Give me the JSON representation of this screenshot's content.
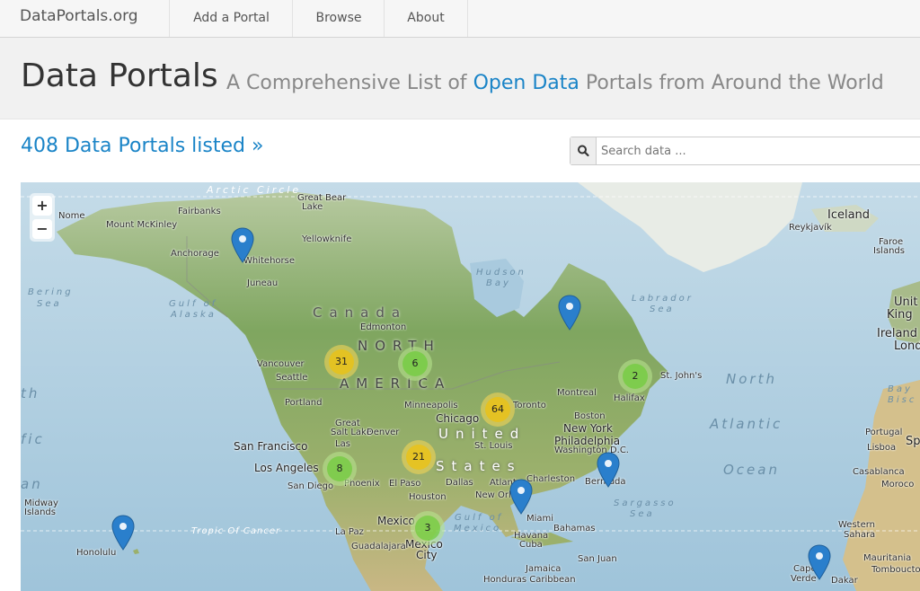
{
  "nav": {
    "brand": "DataPortals.org",
    "items": [
      {
        "label": "Add a Portal"
      },
      {
        "label": "Browse"
      },
      {
        "label": "About"
      }
    ]
  },
  "hero": {
    "title": "Data Portals",
    "subtitle_before": "A Comprehensive List of",
    "subtitle_highlight": "Open Data",
    "subtitle_after": "Portals from Around the World"
  },
  "count_link": "408 Data Portals listed »",
  "search": {
    "placeholder": "Search data ...",
    "value": ""
  },
  "map": {
    "zoom_in": "+",
    "zoom_out": "−",
    "clusters": [
      {
        "count": "31"
      },
      {
        "count": "6"
      },
      {
        "count": "64"
      },
      {
        "count": "2"
      },
      {
        "count": "21"
      },
      {
        "count": "8"
      },
      {
        "count": "3"
      }
    ],
    "markers_count": 6,
    "labels": {
      "arctic_circle": "Arctic Circle",
      "great_bear_lake": "Great Bear",
      "great_bear_lake2": "Lake",
      "nome": "Nome",
      "fairbanks": "Fairbanks",
      "mount_mckinley": "Mount McKinley",
      "anchorage": "Anchorage",
      "whitehorse": "Whitehorse",
      "yellowknife": "Yellowknife",
      "juneau": "Juneau",
      "bering_sea": "Bering",
      "bering_sea2": "Sea",
      "gulf_alaska": "Gulf of",
      "gulf_alaska2": "Alaska",
      "hudson_bay": "Hudson",
      "hudson_bay2": "Bay",
      "canada": "Canada",
      "edmonton": "Edmonton",
      "north": "NORTH",
      "america": "AMERICA",
      "vancouver": "Vancouver",
      "seattle": "Seattle",
      "portland": "Portland",
      "minneapolis": "Minneapolis",
      "chicago": "Chicago",
      "toronto": "Toronto",
      "montreal": "Montreal",
      "halifax": "Halifax",
      "st_johns": "St. John's",
      "boston": "Boston",
      "new_york": "New York",
      "philadelphia": "Philadelphia",
      "washington": "Washington D.C.",
      "united": "United",
      "states": "States",
      "great_salt_lake": "Great",
      "great_salt_lake2": "Salt Lake",
      "denver": "Denver",
      "las_vegas": "Las",
      "st_louis": "St. Louis",
      "san_francisco": "San Francisco",
      "los_angeles": "Los Angeles",
      "san_diego": "San Diego",
      "phoenix": "Phoenix",
      "el_paso": "El Paso",
      "dallas": "Dallas",
      "houston": "Houston",
      "atlanta": "Atlanta",
      "charleston": "Charleston",
      "new_orleans": "New Orle",
      "bermuda": "Bermuda",
      "miami": "Miami",
      "gulf_mexico": "Gulf of",
      "gulf_mexico2": "Mexico",
      "havana": "Havana",
      "cuba": "Cuba",
      "bahamas": "Bahamas",
      "mexico": "Mexico",
      "mexico_city": "Mexico",
      "mexico_city2": "City",
      "la_paz": "La Paz",
      "guadalajara": "Guadalajara",
      "tropic": "Tropic Of Cancer",
      "honolulu": "Honolulu",
      "midway": "Midway",
      "midway2": "Islands",
      "jamaica": "Jamaica",
      "caribbean": "Honduras  Caribbean",
      "san_juan": "San Juan",
      "sargasso": "Sargasso",
      "sargasso2": "Sea",
      "north_atlantic": "North",
      "atlantic": "Atlantic",
      "ocean": "Ocean",
      "labrador": "Labrador",
      "labrador2": "Sea",
      "iceland": "Iceland",
      "reykjavik": "Reykjavík",
      "faroe": "Faroe",
      "faroe2": "Islands",
      "united_kingdom": "Unit",
      "united_kingdom2": "King",
      "ireland": "Ireland",
      "london": "Lond",
      "bay_biscay": "Bay",
      "bay_biscay2": "Bisc",
      "portugal": "Portugal",
      "spain": "Sp",
      "lisboa": "Lisboa",
      "casablanca": "Casablanca",
      "morocco": "Moroco",
      "western_sahara": "Western",
      "western_sahara2": "Sahara",
      "mauritania": "Mauritania",
      "tombouctou": "Tombouctou",
      "cape_verde": "Cape",
      "cape_verde2": "Verde",
      "dakar": "Dakar",
      "pacific_th": "th",
      "pacific_fic": "fic",
      "pacific_an": "an"
    }
  }
}
